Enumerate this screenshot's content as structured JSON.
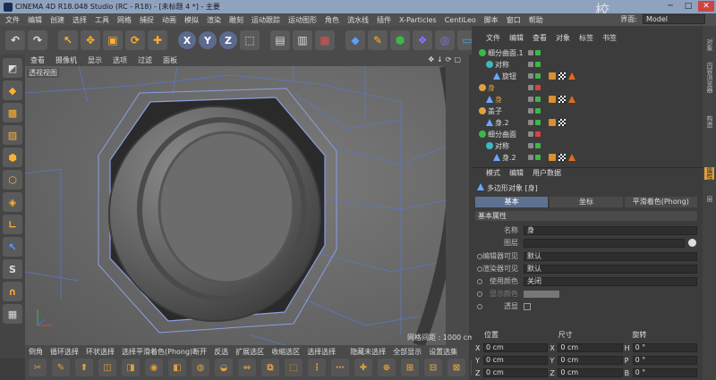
{
  "titlebar": {
    "title": "CINEMA 4D R18.048 Studio (RC - R18) - [未标题 4 *] - 主要",
    "min": "─",
    "max": "□",
    "close": "✕"
  },
  "menubar": {
    "items": [
      "文件",
      "编辑",
      "创建",
      "选择",
      "工具",
      "网格",
      "捕捉",
      "动画",
      "模拟",
      "渲染",
      "雕刻",
      "运动跟踪",
      "运动图形",
      "角色",
      "流水线",
      "插件",
      "X-Particles",
      "CentiLeo",
      "脚本",
      "窗口",
      "帮助"
    ],
    "layout_label": "界面:",
    "layout_value": "Model"
  },
  "watermark": "校",
  "viewport": {
    "menu": [
      "查看",
      "摄像机",
      "显示",
      "选项",
      "过滤",
      "面板"
    ],
    "nav_icons": "✥↓⟳▢",
    "label": "透视视图",
    "grid_label": "网格间距 : 1000 cm"
  },
  "bottom_toolbar": {
    "labels": [
      "倒角",
      "循环选择",
      "环状选择",
      "选择平滑着色(Phong)断开",
      "反选",
      "扩展选区",
      "收缩选区",
      "选择选择",
      "",
      "隐藏未选择",
      "全部显示",
      "设置选集"
    ]
  },
  "object_manager": {
    "menu": [
      "文件",
      "编辑",
      "查看",
      "对象",
      "标签",
      "书签"
    ],
    "rows": [
      {
        "name": "细分曲面.1"
      },
      {
        "name": "对称"
      },
      {
        "name": "旋钮"
      },
      {
        "name": "身"
      },
      {
        "name": "盖子"
      },
      {
        "name": "身.2"
      },
      {
        "name": "细分曲面"
      },
      {
        "name": "对称"
      },
      {
        "name": "身.2"
      }
    ]
  },
  "attribute_manager": {
    "menu": [
      "模式",
      "编辑",
      "用户数据"
    ],
    "title": "多边形对象 [身]",
    "tabs": [
      "基本",
      "坐标",
      "平滑着色(Phong)"
    ],
    "section": "基本属性",
    "props": [
      {
        "label": "名称",
        "value": "身"
      },
      {
        "label": "图层",
        "value": ""
      },
      {
        "label": "编辑器可见",
        "value": "默认"
      },
      {
        "label": "渲染器可见",
        "value": "默认"
      },
      {
        "label": "使用颜色",
        "value": "关闭"
      },
      {
        "label": "显示颜色",
        "value": ""
      },
      {
        "label": "透显",
        "value": ""
      }
    ]
  },
  "coordinates": {
    "headers": [
      "位置",
      "尺寸",
      "旋转"
    ],
    "rows": [
      {
        "pos_axis": "X",
        "pos": "0 cm",
        "size_axis": "X",
        "size": "0 cm",
        "rot_axis": "H",
        "rot": "0 °"
      },
      {
        "pos_axis": "Y",
        "pos": "0 cm",
        "size_axis": "Y",
        "size": "0 cm",
        "rot_axis": "P",
        "rot": "0 °"
      },
      {
        "pos_axis": "Z",
        "pos": "0 cm",
        "size_axis": "Z",
        "size": "0 cm",
        "rot_axis": "B",
        "rot": "0 °"
      }
    ]
  },
  "side_tabs": [
    "对象",
    "内容浏览器",
    "构造",
    "属性",
    "层"
  ]
}
